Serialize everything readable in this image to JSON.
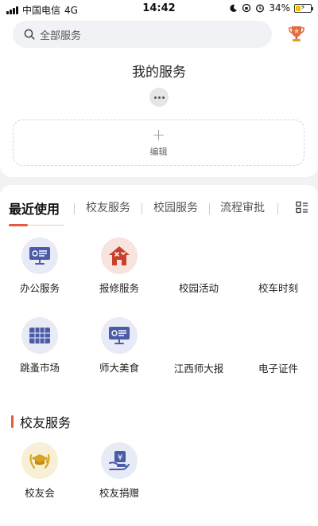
{
  "status_bar": {
    "carrier": "中国电信",
    "network": "4G",
    "time": "14:42",
    "battery_text": "34%",
    "battery_level": 0.34
  },
  "search": {
    "placeholder": "全部服务"
  },
  "my_services": {
    "title": "我的服务",
    "edit_label": "编辑"
  },
  "tabs": [
    {
      "label": "最近使用",
      "active": true
    },
    {
      "label": "校友服务",
      "active": false
    },
    {
      "label": "校园服务",
      "active": false
    },
    {
      "label": "流程审批",
      "active": false
    }
  ],
  "recent": [
    {
      "label": "办公服务",
      "icon": "monitor-icon"
    },
    {
      "label": "报修服务",
      "icon": "repair-house-icon"
    },
    {
      "label": "校园活动",
      "icon": null
    },
    {
      "label": "校车时刻",
      "icon": null
    },
    {
      "label": "跳蚤市场",
      "icon": "market-grid-icon"
    },
    {
      "label": "师大美食",
      "icon": "monitor-icon"
    },
    {
      "label": "江西师大报",
      "icon": null
    },
    {
      "label": "电子证件",
      "icon": null
    }
  ],
  "alumni_section": {
    "title": "校友服务",
    "items": [
      {
        "label": "校友会",
        "icon": "graduation-cap-icon"
      },
      {
        "label": "校友捐赠",
        "icon": "donation-icon"
      }
    ]
  },
  "colors": {
    "accent": "#e35b3c",
    "icon_blue": "#4a5ca8",
    "icon_red": "#c9402b",
    "icon_gold": "#d9a520"
  }
}
